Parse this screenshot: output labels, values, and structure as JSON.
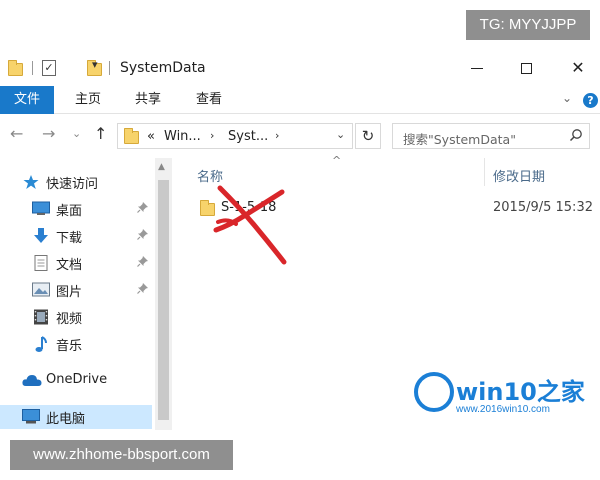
{
  "watermark_top": "TG: MYYJJPP",
  "watermark_bottom": "www.zhhome-bbsport.com",
  "window": {
    "title": "SystemData",
    "min_icon": "minimize-icon",
    "max_icon": "maximize-icon",
    "close_symbol": "✕"
  },
  "ribbon": {
    "tabs": [
      "文件",
      "主页",
      "共享",
      "查看"
    ],
    "help_symbol": "?",
    "expand_symbol": "⌄"
  },
  "nav": {
    "back": "←",
    "forward": "→",
    "recent": "⌄",
    "up": "↑",
    "breadcrumb_prefix": "«",
    "crumbs": [
      "Win...",
      "Syst..."
    ],
    "crumb_sep": "›",
    "address_dropdown": "⌄",
    "refresh": "↻",
    "search_placeholder": "搜索\"SystemData\"",
    "search_icon": "⌕"
  },
  "sidebar": {
    "items": [
      {
        "label": "快速访问",
        "icon": "star-icon",
        "pinned": false
      },
      {
        "label": "桌面",
        "icon": "desktop-icon",
        "pinned": true
      },
      {
        "label": "下载",
        "icon": "download-icon",
        "pinned": true
      },
      {
        "label": "文档",
        "icon": "document-icon",
        "pinned": true
      },
      {
        "label": "图片",
        "icon": "picture-icon",
        "pinned": true
      },
      {
        "label": "视频",
        "icon": "video-icon",
        "pinned": false
      },
      {
        "label": "音乐",
        "icon": "music-icon",
        "pinned": false
      },
      {
        "label": "OneDrive",
        "icon": "cloud-icon",
        "pinned": false
      },
      {
        "label": "此电脑",
        "icon": "computer-icon",
        "pinned": false
      }
    ],
    "pin_symbol": "📌"
  },
  "columns": {
    "name": "名称",
    "modified": "修改日期",
    "sort_symbol": "^"
  },
  "files": [
    {
      "name": "S-1-5-18",
      "modified": "2015/9/5 15:32",
      "icon": "folder-icon"
    }
  ],
  "logo": {
    "text": "win10之家",
    "url": "www.2016win10.com"
  },
  "colors": {
    "accent": "#1979ca",
    "selection": "#cce8ff",
    "scribble": "#d9262a"
  }
}
